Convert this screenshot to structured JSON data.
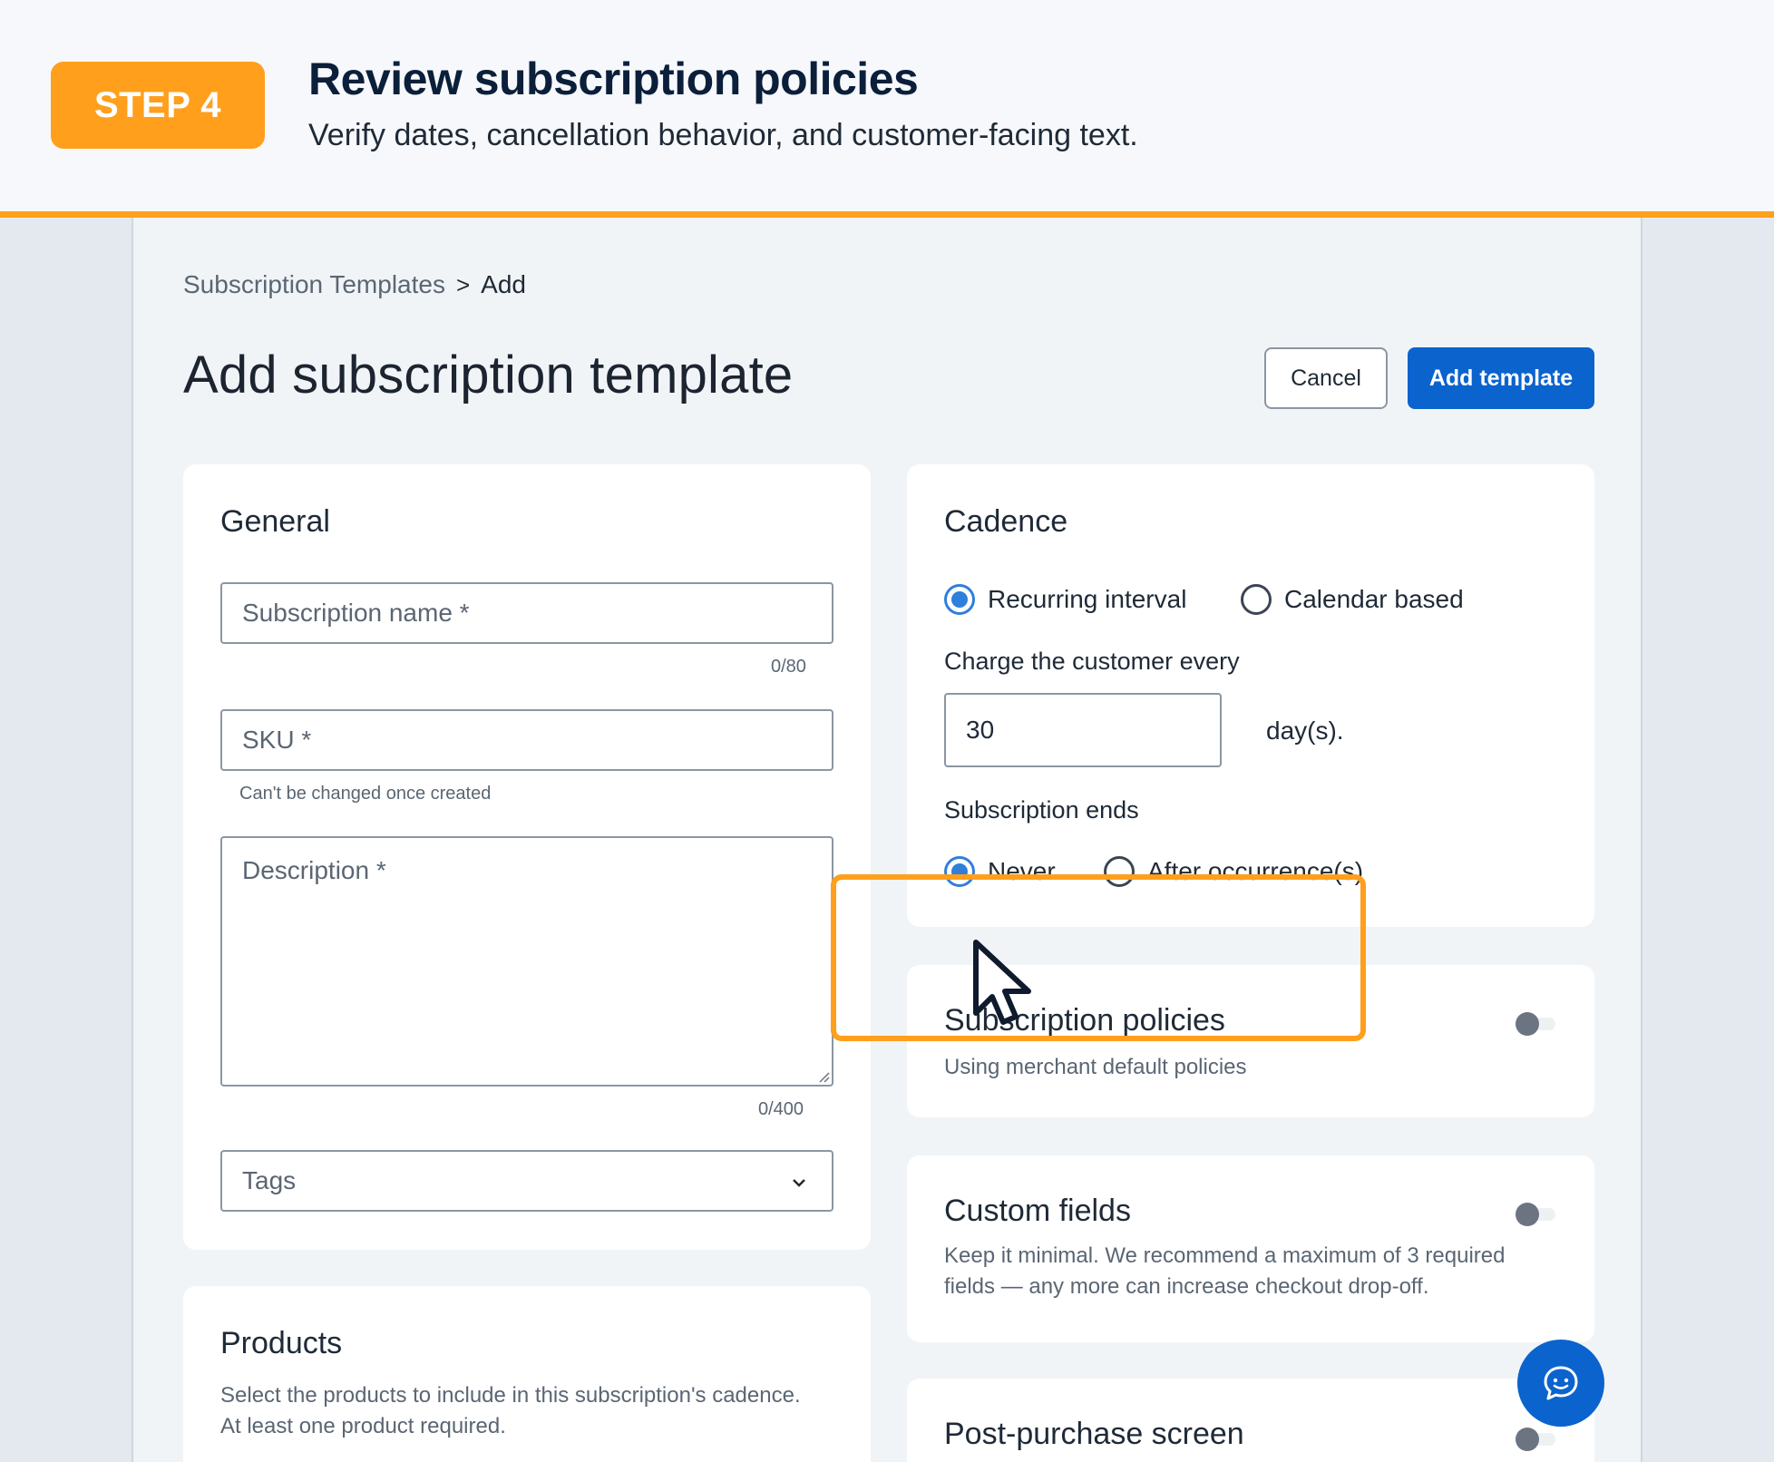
{
  "banner": {
    "step": "STEP 4",
    "title": "Review subscription policies",
    "subtitle": "Verify dates, cancellation behavior, and customer-facing text."
  },
  "breadcrumb": {
    "parent": "Subscription Templates",
    "separator": ">",
    "current": "Add"
  },
  "page": {
    "title": "Add subscription template"
  },
  "actions": {
    "cancel": "Cancel",
    "add": "Add template"
  },
  "general": {
    "title": "General",
    "name_placeholder": "Subscription name *",
    "name_counter": "0/80",
    "sku_placeholder": "SKU *",
    "sku_helper": "Can't be changed once created",
    "description_placeholder": "Description *",
    "description_counter": "0/400",
    "tags_placeholder": "Tags"
  },
  "products": {
    "title": "Products",
    "description": "Select the products to include in this subscription's cadence. At least one product required."
  },
  "cadence": {
    "title": "Cadence",
    "option_recurring": "Recurring interval",
    "option_calendar": "Calendar based",
    "charge_label": "Charge the customer every",
    "interval_value": "30",
    "interval_unit": "day(s).",
    "ends_label": "Subscription ends",
    "ends_never": "Never",
    "ends_after": "After occurrence(s)"
  },
  "policies": {
    "title": "Subscription policies",
    "description": "Using merchant default policies",
    "enabled": false
  },
  "custom_fields": {
    "title": "Custom fields",
    "description": "Keep it minimal. We recommend a maximum of 3 required fields — any more can increase checkout drop-off.",
    "enabled": false
  },
  "post_purchase": {
    "title": "Post-purchase screen",
    "enabled": false
  },
  "colors": {
    "accent": "#ff9f1c",
    "primary": "#0b63ce",
    "radio": "#2f7fdd"
  },
  "icons": {
    "chevron": "chevron-down-icon",
    "chat": "chat-icon",
    "cursor": "cursor-pointer-icon"
  }
}
